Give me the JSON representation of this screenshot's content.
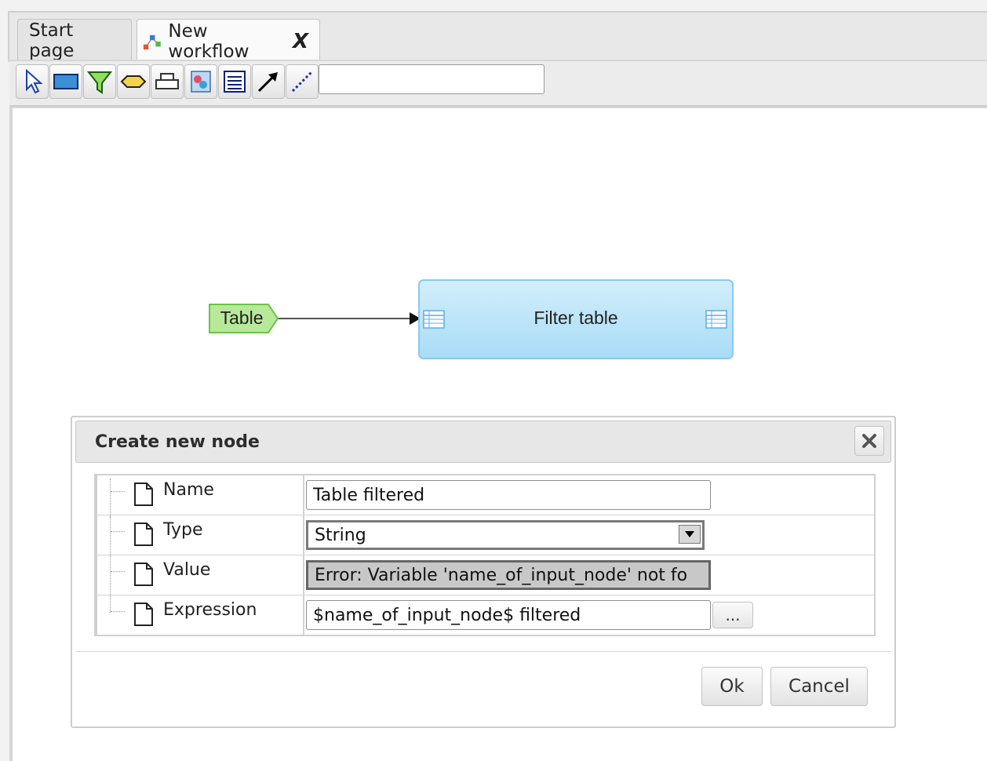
{
  "tabs": [
    {
      "label": "Start page"
    },
    {
      "label": "New workflow",
      "close": "X",
      "icon": "workflow-icon"
    }
  ],
  "toolbar": {
    "tools": [
      "select-pointer-icon",
      "rectangle-node-icon",
      "filter-node-icon",
      "hexagon-node-icon",
      "output-node-icon",
      "transform-node-icon",
      "document-node-icon",
      "arrow-connector-icon",
      "dotted-connector-icon"
    ],
    "search_value": ""
  },
  "workflow": {
    "input_node": "Table",
    "process_node": "Filter table",
    "colors": {
      "input_fill": "#b8e89a",
      "input_stroke": "#6cc24a",
      "process_fill": "#b8e3f8",
      "process_stroke": "#8cc8ec"
    }
  },
  "dialog": {
    "title": "Create new node",
    "rows": [
      {
        "label": "Name",
        "value": "Table filtered"
      },
      {
        "label": "Type",
        "value": "String"
      },
      {
        "label": "Value",
        "value": "Error: Variable 'name_of_input_node' not fo"
      },
      {
        "label": "Expression",
        "value": "$name_of_input_node$ filtered"
      }
    ],
    "more_label": "...",
    "ok_label": "Ok",
    "cancel_label": "Cancel"
  }
}
